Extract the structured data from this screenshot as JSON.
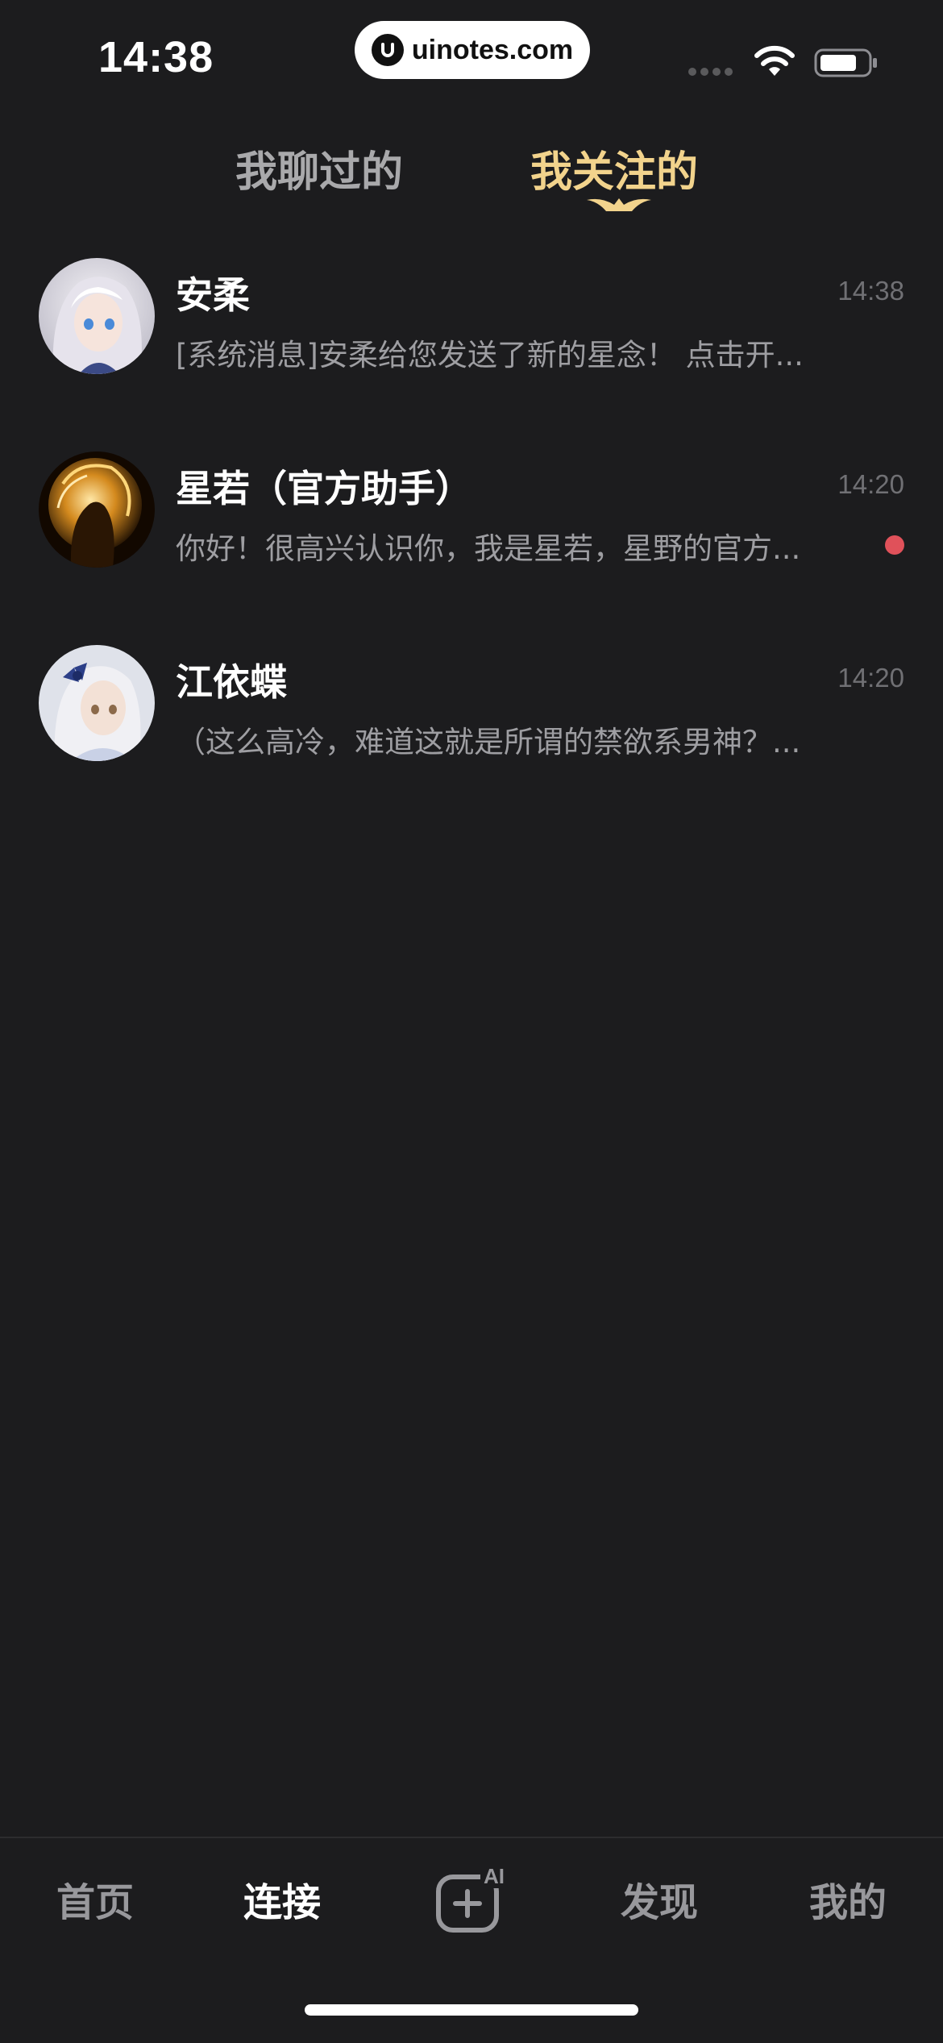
{
  "status_bar": {
    "time": "14:38",
    "watermark": "uinotes.com"
  },
  "tabs": [
    {
      "label": "我聊过的",
      "active": false
    },
    {
      "label": "我关注的",
      "active": true
    }
  ],
  "colors": {
    "background": "#1c1c1e",
    "active_tab": "#f2d38c",
    "inactive_tab": "#a9a9ab",
    "unread_dot": "#e0515a"
  },
  "conversations": [
    {
      "name": "安柔",
      "time": "14:38",
      "preview": "[系统消息]安柔给您发送了新的星念！ 点击开...",
      "unread": false,
      "avatar": "anime-girl-silver-hair-avatar"
    },
    {
      "name": "星若（官方助手）",
      "time": "14:20",
      "preview": "你好！很高兴认识你，我是星若，星野的官方...",
      "unread": true,
      "avatar": "golden-glow-silhouette-avatar"
    },
    {
      "name": "江依蝶",
      "time": "14:20",
      "preview": "（这么高冷，难道这就是所谓的禁欲系男神？...",
      "unread": false,
      "avatar": "anime-girl-blue-bow-avatar"
    }
  ],
  "bottom_nav": {
    "home": "首页",
    "connect": "连接",
    "create_badge": "AI",
    "discover": "发现",
    "mine": "我的",
    "active": "连接"
  }
}
